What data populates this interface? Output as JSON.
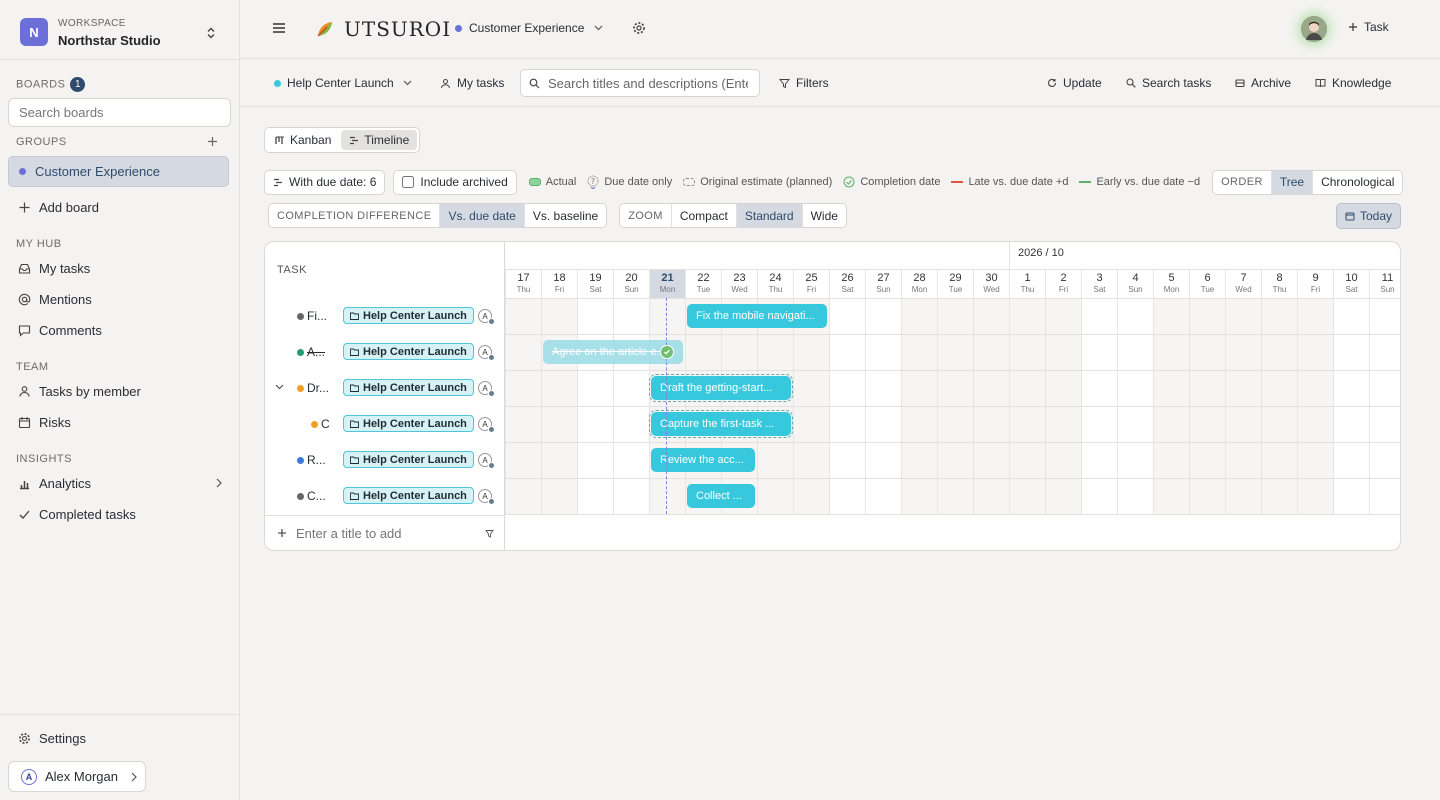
{
  "sidebar": {
    "workspace_caption": "WORKSPACE",
    "workspace_name": "Northstar Studio",
    "workspace_initial": "N",
    "boards_label": "BOARDS",
    "boards_count": "1",
    "search_placeholder": "Search boards",
    "groups_label": "GROUPS",
    "active_board": "Customer Experience",
    "add_board": "Add board",
    "myhub_label": "MY HUB",
    "myhub_items": [
      "My tasks",
      "Mentions",
      "Comments"
    ],
    "team_label": "TEAM",
    "team_items": [
      "Tasks by member",
      "Risks"
    ],
    "insights_label": "INSIGHTS",
    "insights_items": [
      "Analytics",
      "Completed tasks"
    ],
    "settings": "Settings",
    "user_name": "Alex Morgan",
    "user_initial": "A"
  },
  "topbar": {
    "brand": "UTSUROI",
    "board": "Customer Experience",
    "board_color": "#6d6fd8",
    "add_task": "Task"
  },
  "filterbar": {
    "project": "Help Center Launch",
    "project_color": "#38c8dd",
    "my_tasks": "My tasks",
    "search_placeholder": "Search titles and descriptions (Enter)",
    "filters": "Filters",
    "update": "Update",
    "search_tasks": "Search tasks",
    "archive": "Archive",
    "knowledge": "Knowledge"
  },
  "views": {
    "kanban": "Kanban",
    "timeline": "Timeline",
    "active": "Timeline"
  },
  "legend": {
    "due_count": "With due date: 6",
    "include_archived": "Include archived",
    "actual": "Actual",
    "due_only": "Due date only",
    "original_estimate": "Original estimate (planned)",
    "completion": "Completion date",
    "late": "Late vs. due date +d",
    "early": "Early vs. due date −d",
    "order_label": "ORDER",
    "order_tree": "Tree",
    "order_chrono": "Chronological",
    "order_active": "Tree"
  },
  "controls": {
    "completion_label": "COMPLETION DIFFERENCE",
    "vs_due": "Vs. due date",
    "vs_baseline": "Vs. baseline",
    "zoom_label": "ZOOM",
    "compact": "Compact",
    "standard": "Standard",
    "wide": "Wide",
    "today": "Today"
  },
  "timeline": {
    "task_header": "TASK",
    "month_label": "2026 / 10",
    "days": [
      {
        "n": "17",
        "w": "Thu"
      },
      {
        "n": "18",
        "w": "Fri"
      },
      {
        "n": "19",
        "w": "Sat"
      },
      {
        "n": "20",
        "w": "Sun"
      },
      {
        "n": "21",
        "w": "Mon"
      },
      {
        "n": "22",
        "w": "Tue"
      },
      {
        "n": "23",
        "w": "Wed"
      },
      {
        "n": "24",
        "w": "Thu"
      },
      {
        "n": "25",
        "w": "Fri"
      },
      {
        "n": "26",
        "w": "Sat"
      },
      {
        "n": "27",
        "w": "Sun"
      },
      {
        "n": "28",
        "w": "Mon"
      },
      {
        "n": "29",
        "w": "Tue"
      },
      {
        "n": "30",
        "w": "Wed"
      },
      {
        "n": "1",
        "w": "Thu"
      },
      {
        "n": "2",
        "w": "Fri"
      },
      {
        "n": "3",
        "w": "Sat"
      },
      {
        "n": "4",
        "w": "Sun"
      },
      {
        "n": "5",
        "w": "Mon"
      },
      {
        "n": "6",
        "w": "Tue"
      },
      {
        "n": "7",
        "w": "Wed"
      },
      {
        "n": "8",
        "w": "Thu"
      },
      {
        "n": "9",
        "w": "Fri"
      },
      {
        "n": "10",
        "w": "Sat"
      },
      {
        "n": "11",
        "w": "Sun"
      }
    ],
    "tasks": [
      {
        "title": "Fi...",
        "dot": "#666",
        "project": "Help Center Launch",
        "bar": "Fix the mobile navigati..."
      },
      {
        "title": "A...",
        "dot": "#1f9d6b",
        "project": "Help Center Launch",
        "bar": "Agree on the article e..."
      },
      {
        "title": "Dr...",
        "dot": "#f0a020",
        "project": "Help Center Launch",
        "bar": "Draft the getting-start..."
      },
      {
        "title": "C",
        "dot": "#f0a020",
        "project": "Help Center Launch",
        "bar": "Capture the first-task ..."
      },
      {
        "title": "R...",
        "dot": "#3a7bd5",
        "project": "Help Center Launch",
        "bar": "Review the acc..."
      },
      {
        "title": "C...",
        "dot": "#666",
        "project": "Help Center Launch",
        "bar": "Collect ..."
      }
    ],
    "add_placeholder": "Enter a title to add",
    "assignee_initial": "A"
  }
}
